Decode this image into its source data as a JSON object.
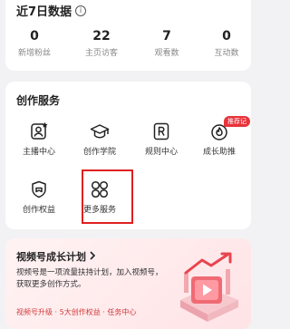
{
  "stats": {
    "title": "近7日数据",
    "items": [
      {
        "value": "0",
        "label": "新增粉丝"
      },
      {
        "value": "22",
        "label": "主页访客"
      },
      {
        "value": "7",
        "label": "观看数"
      },
      {
        "value": "0",
        "label": "互动数"
      }
    ]
  },
  "services": {
    "title": "创作服务",
    "items": [
      {
        "label": "主播中心",
        "icon": "person-star-icon"
      },
      {
        "label": "创作学院",
        "icon": "graduation-cap-icon"
      },
      {
        "label": "规则中心",
        "icon": "rule-book-icon"
      },
      {
        "label": "成长助推",
        "icon": "growth-flame-icon",
        "badge": "推荐记"
      },
      {
        "label": "创作权益",
        "icon": "shield-badge-icon"
      },
      {
        "label": "更多服务",
        "icon": "four-circles-icon"
      }
    ]
  },
  "growth": {
    "title": "视频号成长计划",
    "description": "视频号是一项流量扶持计划，加入视频号，获取更多创作方式。",
    "tags": "视频号升级 · 5大创作权益 · 任务中心"
  },
  "colors": {
    "accent_red": "#e02020",
    "badge_red": "#e8333a"
  }
}
